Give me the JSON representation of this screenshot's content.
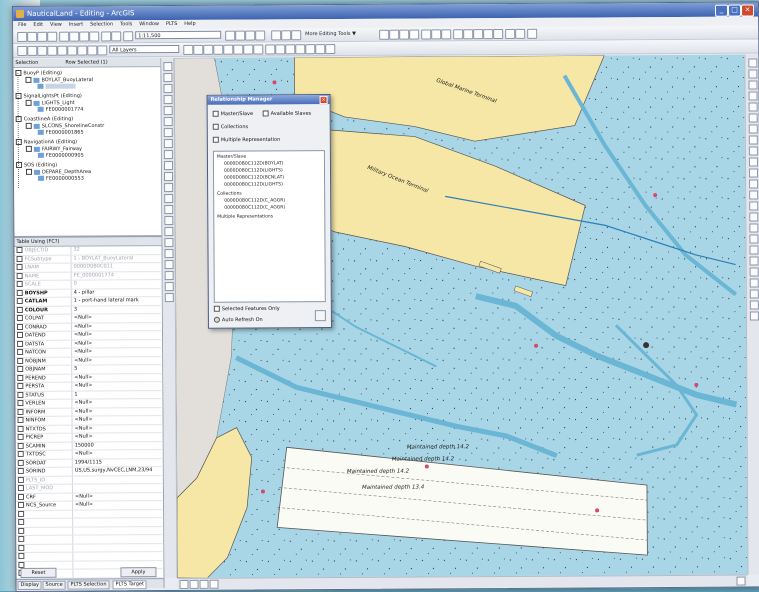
{
  "window": {
    "title": "NauticalLand - Editing - ArcGIS",
    "colors": {
      "title_bar": "#3d62b0",
      "map_water": "#b5dde9",
      "channel": "#6ab6d4",
      "land": "#f6e7a6",
      "grey_land": "#e2dfdb"
    }
  },
  "menu": [
    "File",
    "Edit",
    "View",
    "Insert",
    "Selection",
    "Tools",
    "Window",
    "PLTS",
    "Help"
  ],
  "toolbar": {
    "scale_value": "1:11,500",
    "layer_select": "All Layers",
    "editing_tools_label": "More Editing Tools ▼"
  },
  "left_panel": {
    "header_col1": "Selection",
    "header_col2": "Row Selected (1)",
    "tree": [
      {
        "label": "BuoyP (Editing)",
        "depth": 0
      },
      {
        "label": "BOYLAT_BuoyLateral",
        "depth": 1
      },
      {
        "label": "",
        "depth": 2
      },
      {
        "label": "SignalLightsPt (Editing)",
        "depth": 0
      },
      {
        "label": "LIGHTS_Light",
        "depth": 1
      },
      {
        "label": "FE0000001774",
        "depth": 2
      },
      {
        "label": "CoastlineA (Editing)",
        "depth": 0
      },
      {
        "label": "SLCONS_ShorelineConstr",
        "depth": 1
      },
      {
        "label": "FE0000001865",
        "depth": 2
      },
      {
        "label": "NavigationA (Editing)",
        "depth": 0
      },
      {
        "label": "FAIRWY_Fairway",
        "depth": 1
      },
      {
        "label": "FE0000000905",
        "depth": 2
      },
      {
        "label": "SOS (Editing)",
        "depth": 0
      },
      {
        "label": "DEPARE_DepthArea",
        "depth": 1
      },
      {
        "label": "FE0000000553",
        "depth": 2
      }
    ],
    "attr_header": "Table Using (FC?)",
    "attributes": [
      {
        "k": "OBJECTID",
        "v": "32",
        "gray": true
      },
      {
        "k": "FCSubtype",
        "v": "1 - BOYLAT_BuoyLateral",
        "gray": true
      },
      {
        "k": "LNAM",
        "v": "0000D0B0C011",
        "gray": true
      },
      {
        "k": "NAME",
        "v": "FE_0000001774",
        "gray": true
      },
      {
        "k": "SCALE",
        "v": "0",
        "gray": true
      },
      {
        "k": "BOYSHP",
        "v": "4 - pillar",
        "bold": true
      },
      {
        "k": "CATLAM",
        "v": "1 - port-hand lateral mark",
        "bold": true
      },
      {
        "k": "COLOUR",
        "v": "3",
        "bold": true
      },
      {
        "k": "COLPAT",
        "v": "<Null>"
      },
      {
        "k": "CONRAD",
        "v": "<Null>"
      },
      {
        "k": "DATEND",
        "v": "<Null>"
      },
      {
        "k": "DATSTA",
        "v": "<Null>"
      },
      {
        "k": "NATCON",
        "v": "<Null>"
      },
      {
        "k": "NOBJNM",
        "v": "<Null>"
      },
      {
        "k": "OBJNAM",
        "v": "5"
      },
      {
        "k": "PEREND",
        "v": "<Null>"
      },
      {
        "k": "PERSTA",
        "v": "<Null>"
      },
      {
        "k": "STATUS",
        "v": "1"
      },
      {
        "k": "VERLEN",
        "v": "<Null>"
      },
      {
        "k": "INFORM",
        "v": "<Null>"
      },
      {
        "k": "NINFOM",
        "v": "<Null>"
      },
      {
        "k": "NTXTDS",
        "v": "<Null>"
      },
      {
        "k": "PICREP",
        "v": "<Null>"
      },
      {
        "k": "SCAMIN",
        "v": "150000"
      },
      {
        "k": "TXTDSC",
        "v": "<Null>"
      },
      {
        "k": "SORDAT",
        "v": "1994/1115"
      },
      {
        "k": "SORIND",
        "v": "US,US,surgy,NvCEC,LNM,23/94"
      },
      {
        "k": "PLTS_ID",
        "v": "",
        "gray": true
      },
      {
        "k": "LAST_MOD",
        "v": "",
        "gray": true
      },
      {
        "k": "CRF",
        "v": "<Null>"
      },
      {
        "k": "NCS_Source",
        "v": "<Null>"
      },
      {
        "k": "",
        "v": ""
      },
      {
        "k": "",
        "v": ""
      },
      {
        "k": "",
        "v": ""
      },
      {
        "k": "",
        "v": ""
      },
      {
        "k": "",
        "v": ""
      },
      {
        "k": "",
        "v": ""
      },
      {
        "k": "",
        "v": ""
      },
      {
        "k": "",
        "v": ""
      },
      {
        "k": "",
        "v": ""
      }
    ],
    "buttons": {
      "reset": "Reset",
      "apply": "Apply"
    },
    "tabs": [
      "Display",
      "Source",
      "PLTS Selection",
      "PLTS Target"
    ]
  },
  "relationship_manager": {
    "title": "Relationship Manager",
    "options": {
      "master_slave": "Master/Slave",
      "available_slaves": "Available Slaves",
      "collections": "Collections",
      "multiple_representation": "Multiple Representation"
    },
    "list": [
      {
        "text": "Master/Slave",
        "indent": 0
      },
      {
        "text": "0000D0B0C112D(BOYLAT)",
        "indent": 1
      },
      {
        "text": "0000D0B0C112D(LIGHTS)",
        "indent": 1
      },
      {
        "text": "0000D0B0C112D(BCNLAT)",
        "indent": 1
      },
      {
        "text": "0000D0B0C112D(LIGHTS)",
        "indent": 1
      },
      {
        "text": "Collections",
        "indent": 0
      },
      {
        "text": "0000D0B0C112D(C_AGGR)",
        "indent": 1
      },
      {
        "text": "0000D0B0C112D(C_AGGR)",
        "indent": 1
      },
      {
        "text": "Multiple Representations",
        "indent": 0
      }
    ],
    "selected_features_only": "Selected Features Only",
    "auto_refresh": "Auto Refresh On"
  },
  "map": {
    "labels": {
      "terminal_top": "Global Marine Terminal",
      "terminal_mid": "Military Ocean Terminal",
      "channel1": "Maintained depth 14.2",
      "channel2": "Maintained depth 14.2",
      "channel3": "Maintained depth 14.2",
      "channel4": "Maintained depth 13.4"
    }
  }
}
